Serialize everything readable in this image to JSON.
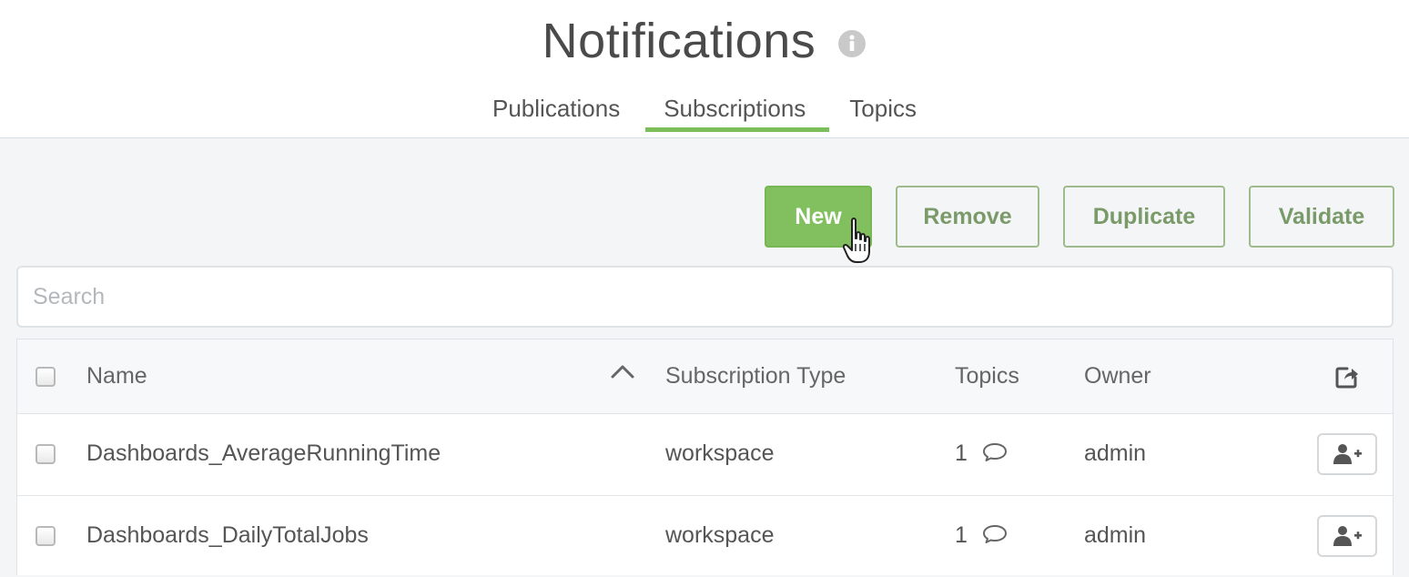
{
  "header": {
    "title": "Notifications",
    "tabs": [
      {
        "label": "Publications",
        "active": false
      },
      {
        "label": "Subscriptions",
        "active": true
      },
      {
        "label": "Topics",
        "active": false
      }
    ]
  },
  "toolbar": {
    "new_label": "New",
    "remove_label": "Remove",
    "duplicate_label": "Duplicate",
    "validate_label": "Validate"
  },
  "search": {
    "placeholder": "Search",
    "value": ""
  },
  "table": {
    "columns": {
      "name": "Name",
      "subscription_type": "Subscription Type",
      "topics": "Topics",
      "owner": "Owner"
    },
    "sort": {
      "column": "Name",
      "direction": "ascending"
    },
    "rows": [
      {
        "name": "Dashboards_AverageRunningTime",
        "subscription_type": "workspace",
        "topics": "1",
        "owner": "admin"
      },
      {
        "name": "Dashboards_DailyTotalJobs",
        "subscription_type": "workspace",
        "topics": "1",
        "owner": "admin"
      }
    ]
  },
  "icons": {
    "title_info": "info-circle-icon",
    "sort": "chevron-up-icon",
    "export": "export-icon",
    "topics": "speech-bubble-icon",
    "row_action": "add-user-icon",
    "cursor": "hand-pointer-cursor"
  },
  "colors": {
    "accent_green": "#82bf5f",
    "outline_green": "#9fba8d",
    "background": "#f4f5f6"
  }
}
